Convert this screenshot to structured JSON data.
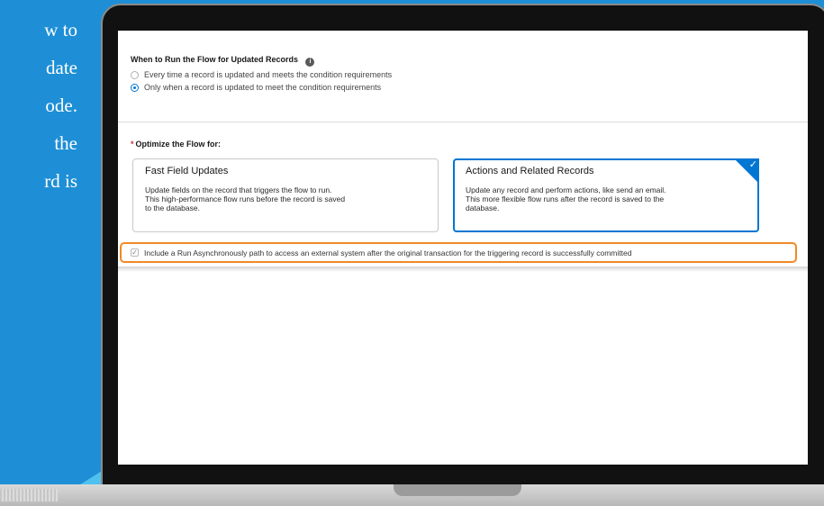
{
  "side_text": [
    "w to",
    "date",
    "ode.",
    "the",
    "rd is"
  ],
  "section_run": {
    "label": "When to Run the Flow for Updated Records",
    "info_icon": "info-icon",
    "options": [
      {
        "label": "Every time a record is updated and meets the condition requirements",
        "selected": false
      },
      {
        "label": "Only when a record is updated to meet the condition requirements",
        "selected": true
      }
    ]
  },
  "section_optimize": {
    "required_mark": "*",
    "label": "Optimize the Flow for:",
    "cards": [
      {
        "title": "Fast Field Updates",
        "desc": "Update fields on the record that triggers the flow to run.\nThis high-performance flow runs before the record is saved\nto the database.",
        "selected": false
      },
      {
        "title": "Actions and Related Records",
        "desc": "Update any record and perform actions, like send an email.\nThis more flexible flow runs after the record is saved to the\ndatabase.",
        "selected": true
      }
    ],
    "selected_check": "✓"
  },
  "async_option": {
    "checked": true,
    "check_glyph": "✓",
    "label": "Include a Run Asynchronously path to access an external system after the original transaction for the triggering record is successfully committed"
  },
  "colors": {
    "background": "#1e8fd6",
    "accent": "#0176d3",
    "highlight": "#f08a24"
  }
}
